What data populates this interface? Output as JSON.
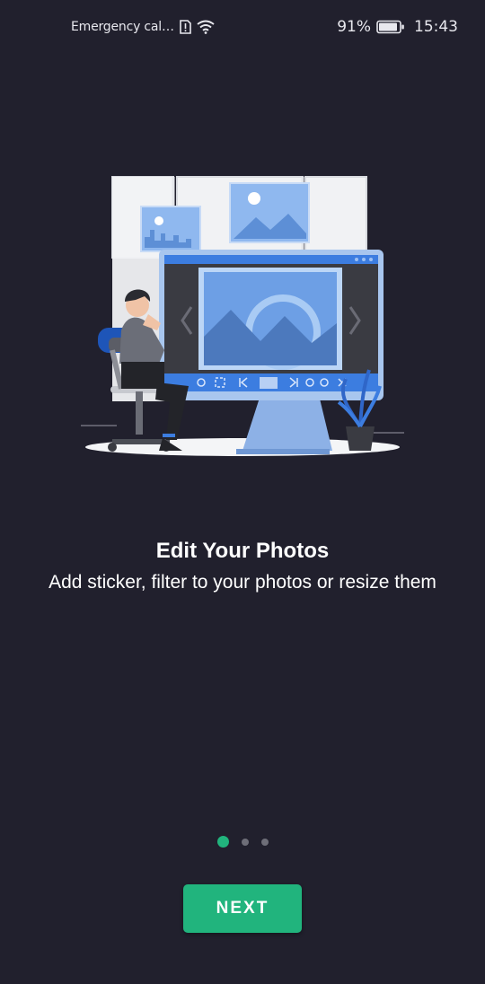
{
  "status_bar": {
    "carrier": "Emergency cal…",
    "battery_percent": "91%",
    "battery_level": 0.91,
    "time": "15:43"
  },
  "onboarding": {
    "title": "Edit Your Photos",
    "subtitle": "Add sticker, filter to your photos or resize them",
    "page_index": 0,
    "page_count": 3,
    "next_label": "NEXT"
  },
  "colors": {
    "background": "#21202d",
    "accent": "#21b47d",
    "dot_inactive": "#6e6e78"
  }
}
